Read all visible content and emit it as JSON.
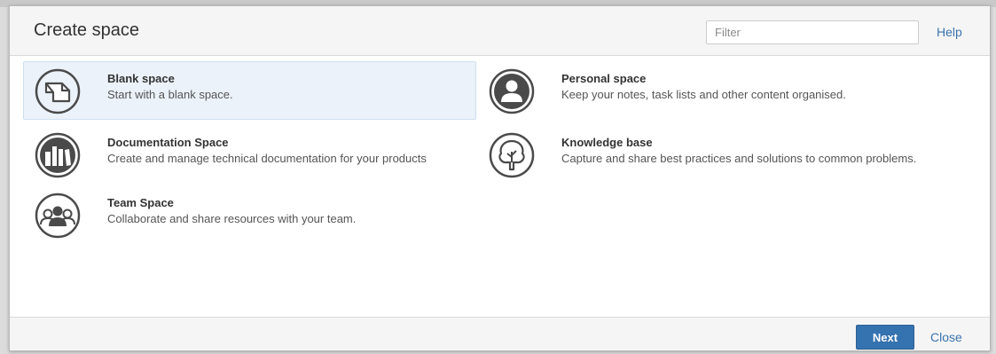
{
  "dialog": {
    "title": "Create space",
    "filter_placeholder": "Filter",
    "filter_value": "",
    "help_label": "Help"
  },
  "blueprints": [
    {
      "icon": "blank-page-icon",
      "title": "Blank space",
      "description": "Start with a blank space.",
      "selected": true
    },
    {
      "icon": "person-icon",
      "title": "Personal space",
      "description": "Keep your notes, task lists and other content organised.",
      "selected": false
    },
    {
      "icon": "books-icon",
      "title": "Documentation Space",
      "description": "Create and manage technical documentation for your products",
      "selected": false
    },
    {
      "icon": "tree-icon",
      "title": "Knowledge base",
      "description": "Capture and share best practices and solutions to common problems.",
      "selected": false
    },
    {
      "icon": "team-icon",
      "title": "Team Space",
      "description": "Collaborate and share resources with your team.",
      "selected": false
    }
  ],
  "footer": {
    "next_label": "Next",
    "close_label": "Close"
  },
  "colors": {
    "accent": "#3572b0",
    "link": "#3b73af",
    "selected_bg": "#ebf2f9",
    "icon": "#4a4a4a"
  }
}
